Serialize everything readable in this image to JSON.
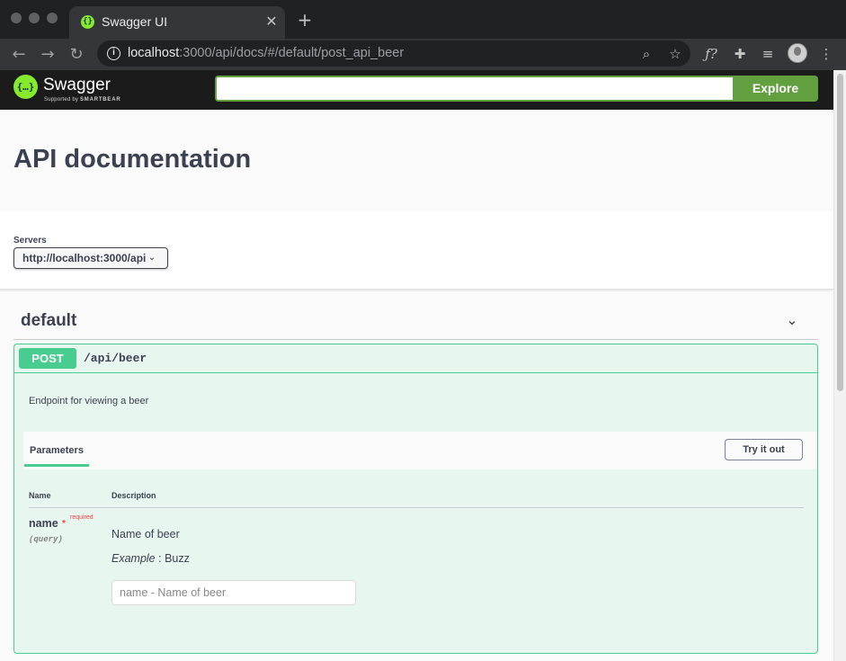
{
  "browser": {
    "tab_title": "Swagger UI",
    "url_host": "localhost",
    "url_rest": ":3000/api/docs/#/default/post_api_beer",
    "icons": {
      "back": "back-arrow-icon",
      "forward": "forward-arrow-icon",
      "reload": "reload-icon",
      "site_info": "info-icon",
      "zoom": "zoom-icon",
      "bookmark": "star-icon",
      "function_ext": "function-extension-icon",
      "extensions": "puzzle-icon",
      "media": "media-queue-icon",
      "profile": "avatar",
      "menu": "kebab-menu-icon"
    }
  },
  "topbar": {
    "logo_text": "Swagger",
    "logo_sub_prefix": "Supported by",
    "logo_sub_brand": "SMARTBEAR",
    "explore_value": "",
    "explore_label": "Explore"
  },
  "info": {
    "title": "API documentation"
  },
  "servers": {
    "label": "Servers",
    "selected": "http://localhost:3000/api"
  },
  "tag": {
    "name": "default"
  },
  "operation": {
    "method": "POST",
    "path": "/api/beer",
    "description": "Endpoint for viewing a beer",
    "parameters_tab": "Parameters",
    "try_it_out": "Try it out",
    "columns": {
      "name": "Name",
      "description": "Description"
    },
    "param": {
      "name": "name",
      "required_star": "*",
      "required_text": "required",
      "in": "(query)",
      "description": "Name of beer",
      "example_label": "Example",
      "example_sep": " : ",
      "example_value": "Buzz",
      "placeholder": "name - Name of beer"
    }
  },
  "colors": {
    "post_accent": "#49cc90",
    "post_background": "#e8f6f0",
    "swagger_green": "#62a03f",
    "topbar_background": "#1b1b1b",
    "required_red": "#f93e3e"
  }
}
